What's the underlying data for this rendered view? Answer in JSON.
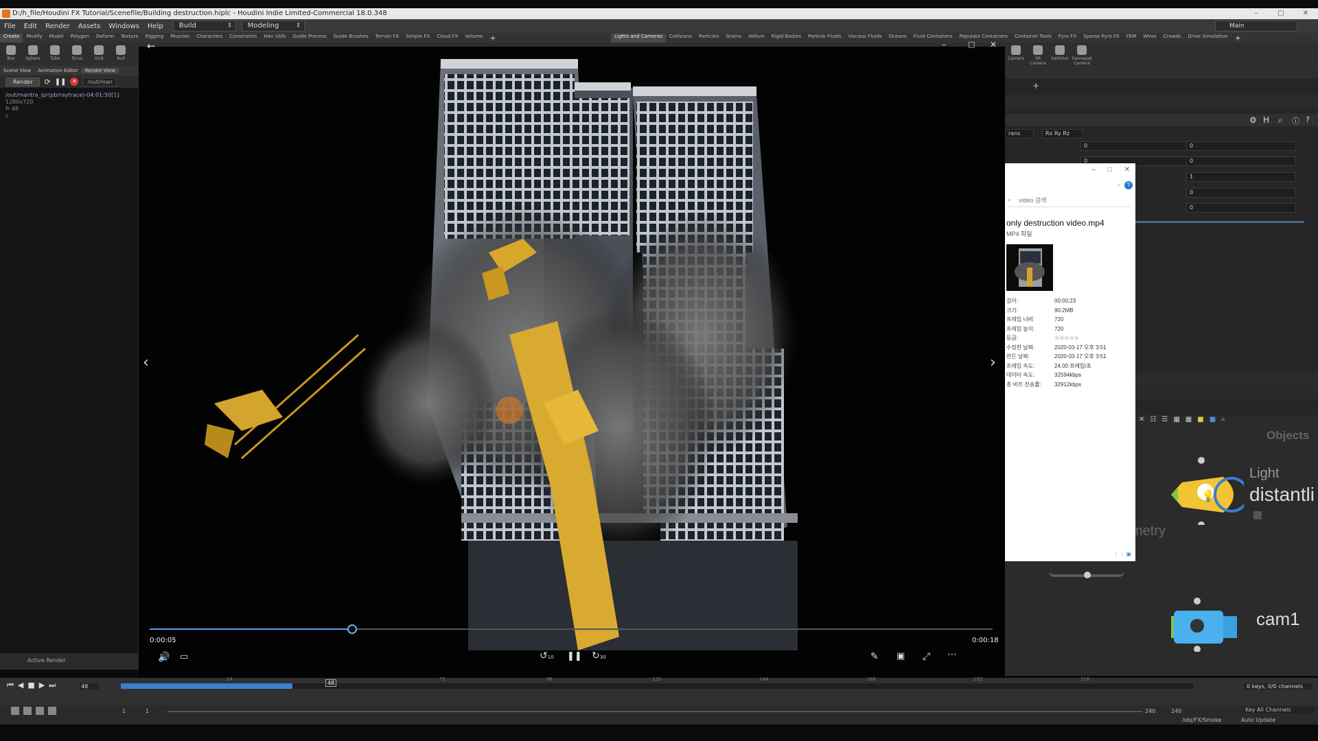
{
  "window": {
    "title": "D:/h_file/Houdini FX Tutorial/Scenefile/Building destruction.hiplc - Houdini Indie Limited-Commercial 18.0.348"
  },
  "menu": {
    "items": [
      "File",
      "Edit",
      "Render",
      "Assets",
      "Windows",
      "Help"
    ],
    "desktop": "Build",
    "context": "Modeling",
    "desktop_right": "Main"
  },
  "shelf_tabs_left": [
    "Create",
    "Modify",
    "Model",
    "Polygon",
    "Deform",
    "Texture",
    "Rigging",
    "Muscles",
    "Characters",
    "Constraints",
    "Hair Utils",
    "Guide Process",
    "Guide Brushes",
    "Terrain FX",
    "Simple FX",
    "Cloud FX",
    "Volume"
  ],
  "shelf_tabs_right": [
    "Lights and Cameras",
    "Collisions",
    "Particles",
    "Grains",
    "Vellum",
    "Rigid Bodies",
    "Particle Fluids",
    "Viscous Fluids",
    "Oceans",
    "Fluid Containers",
    "Populate Containers",
    "Container Tools",
    "Pyro FX",
    "Sparse Pyro FX",
    "FEM",
    "Wires",
    "Crowds",
    "Drive Simulation"
  ],
  "shelf_tools_left": [
    "Box",
    "Sphere",
    "Tube",
    "Torus",
    "Grid",
    "Null"
  ],
  "shelf_tools_right": [
    "Camera",
    "VR Camera",
    "Switcher",
    "Gamepad Camera"
  ],
  "left_pane": {
    "tabs": [
      "Scene View",
      "Animation Editor",
      "Render View"
    ],
    "render_button": "Render",
    "out_path": "/out/man",
    "ipr_path": "/out/mantra_ipr(pbrraytrace)-04:01:50[1]",
    "ipr_res": "1280x720",
    "ipr_frame": "fr 48",
    "ipr_c": "c",
    "active_render": "Active Render"
  },
  "player": {
    "current_time": "0:00:05",
    "total_time": "0:00:18",
    "progress": 0.24,
    "skip_back": "10",
    "skip_fwd": "30"
  },
  "props": {
    "search_placeholder": "video 검색",
    "file_name": "only destruction video.mp4",
    "file_type": "MP4 파일",
    "rows": [
      {
        "k": "길이:",
        "v": "00:00:23"
      },
      {
        "k": "크기:",
        "v": "90.2MB"
      },
      {
        "k": "프레임 너비:",
        "v": "720"
      },
      {
        "k": "프레임 높이:",
        "v": "720"
      },
      {
        "k": "등급:",
        "v": "☆☆☆☆☆"
      },
      {
        "k": "수정한 날짜:",
        "v": "2020-03-17 오후 3:51"
      },
      {
        "k": "만든 날짜:",
        "v": "2020-03-17 오후 3:51"
      },
      {
        "k": "프레임 속도:",
        "v": "24.00 프레임/초"
      },
      {
        "k": "데이터 속도:",
        "v": "32594kbps"
      },
      {
        "k": "총 비트 전송률:",
        "v": "32912kbps"
      }
    ]
  },
  "param_panel": {
    "xform_label": "rans",
    "rot_order": "Rx Ry Rz",
    "values_a": [
      "0",
      "0"
    ],
    "values_b": [
      "0",
      "0",
      "1",
      "0",
      "0"
    ]
  },
  "network": {
    "objects_label": "Objects",
    "light_type": "Light",
    "light_name": "distantli",
    "geo_partial": "metry",
    "cam_name": "cam1"
  },
  "timeline": {
    "current_frame": "48",
    "marker_frame": "48",
    "ticks": [
      "24",
      "72",
      "96",
      "120",
      "144",
      "168",
      "192",
      "216"
    ],
    "start": "1",
    "start2": "1",
    "end": "240",
    "end2": "240",
    "progress": 0.16,
    "keys": "0 keys, 0/0 channels",
    "key_all": "Key All Channels",
    "auto_update": "Auto Update",
    "status_path": "/obj/FX/Smoke"
  }
}
